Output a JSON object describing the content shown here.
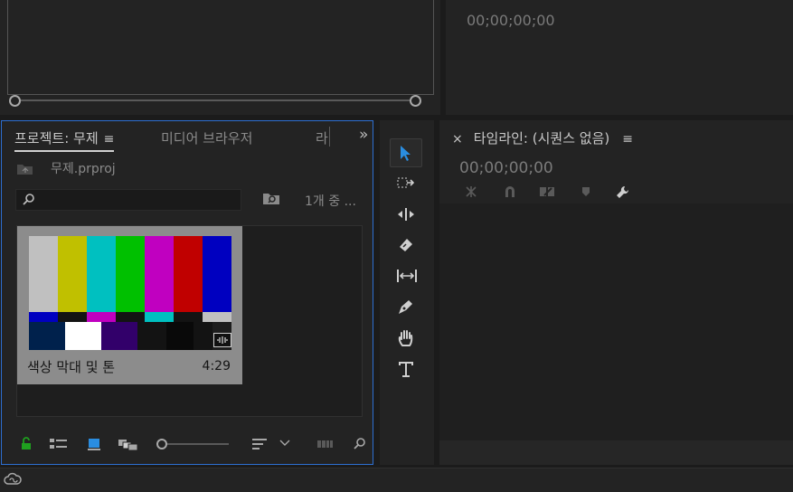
{
  "source_monitor": {},
  "program_monitor": {
    "timecode": "00;00;00;00"
  },
  "project_panel": {
    "tabs": {
      "project": "프로젝트: 무제",
      "media_browser": "미디어 브라우저",
      "libraries": "라"
    },
    "menu_icon": "≡",
    "overflow": "»",
    "file_name": "무제.prproj",
    "item_count": "1개 중 ...",
    "search": {
      "placeholder": ""
    },
    "clip": {
      "name": "색상 막대 및 톤",
      "duration": "4:29"
    }
  },
  "timeline": {
    "close": "×",
    "title": "타임라인: (시퀀스 없음)",
    "menu_icon": "≡",
    "timecode": "00;00;00;00"
  },
  "tools": [
    "select-tool",
    "track-select-tool",
    "ripple-edit-tool",
    "razor-tool",
    "slip-tool",
    "pen-tool",
    "hand-tool",
    "type-tool"
  ],
  "colors": {
    "accent": "#2d6fd2",
    "lock_green": "#1fa01f",
    "list_blue": "#2a8de0",
    "color_bars_top": [
      "#c0c0c0",
      "#c0c000",
      "#00c0c0",
      "#00c000",
      "#c000c0",
      "#c00000",
      "#0000c0"
    ],
    "color_bars_mid": [
      "#0000c0",
      "#131313",
      "#c000c0",
      "#131313",
      "#00c0c0",
      "#131313",
      "#c0c0c0"
    ],
    "color_bars_bottom": [
      "#00214c",
      "#ffffff",
      "#32006a",
      "#131313",
      "#090909",
      "#131313",
      "#1d1d1d"
    ]
  }
}
